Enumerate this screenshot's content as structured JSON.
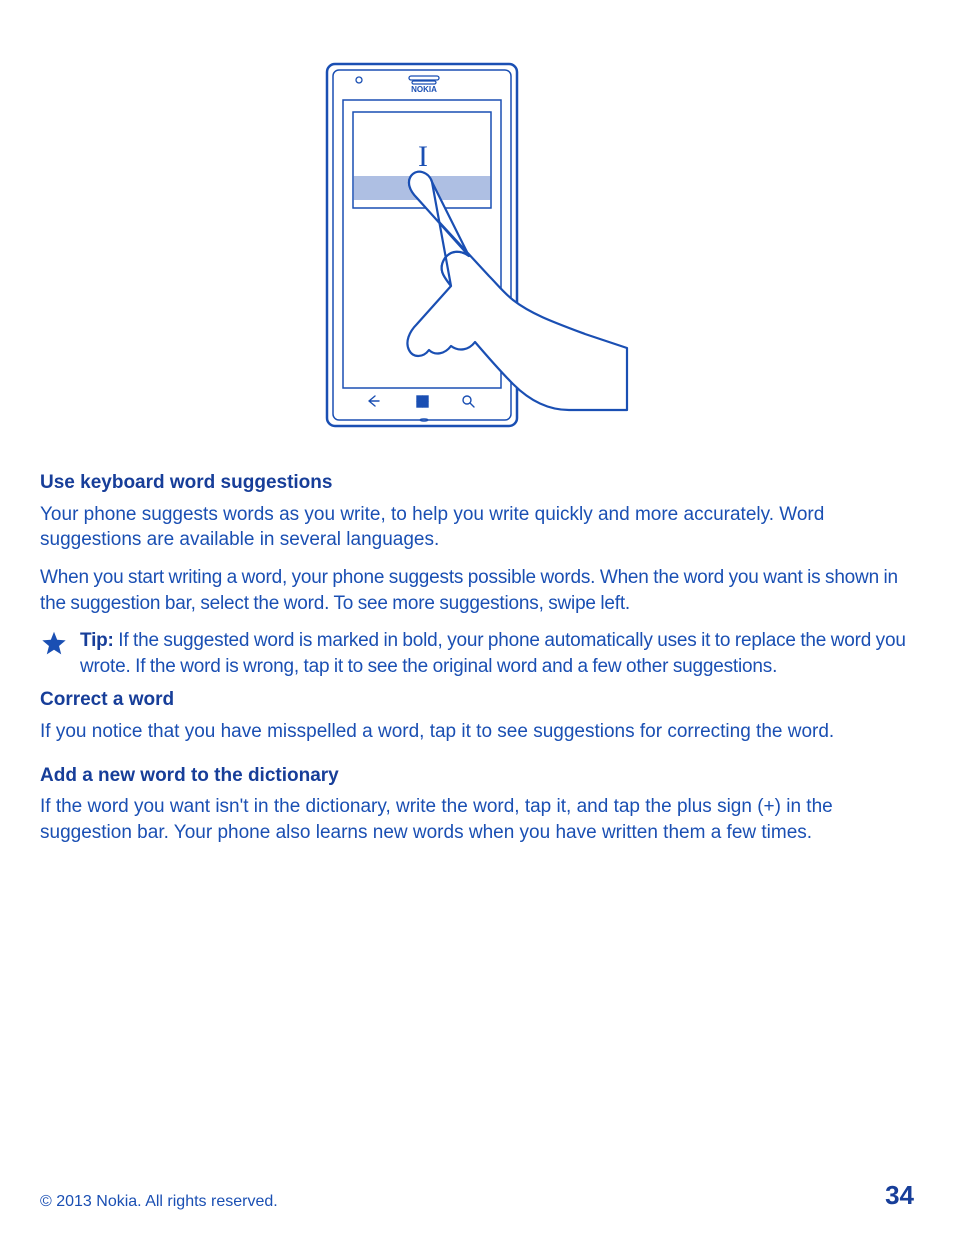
{
  "illustration": {
    "brand": "NOKIA",
    "typed_char": "I"
  },
  "sections": {
    "s1": {
      "title": "Use keyboard word suggestions",
      "p1": "Your phone suggests words as you write, to help you write quickly and more accurately. Word suggestions are available in several languages.",
      "p2": "When you start writing a word, your phone suggests possible words. When the word you want is shown in the suggestion bar, select the word. To see more suggestions, swipe left."
    },
    "tip": {
      "label": "Tip:",
      "text": " If the suggested word is marked in bold, your phone automatically uses it to replace the word you wrote. If the word is wrong, tap it to see the original word and a few other suggestions."
    },
    "s2": {
      "title": "Correct a word",
      "p1": "If you notice that you have misspelled a word, tap it to see suggestions for correcting the word."
    },
    "s3": {
      "title": "Add a new word to the dictionary",
      "p1": "If the word you want isn't in the dictionary, write the word, tap it, and tap the plus sign (+) in the suggestion bar. Your phone also learns new words when you have written them a few times."
    }
  },
  "footer": {
    "copyright": "© 2013 Nokia. All rights reserved.",
    "page": "34"
  }
}
